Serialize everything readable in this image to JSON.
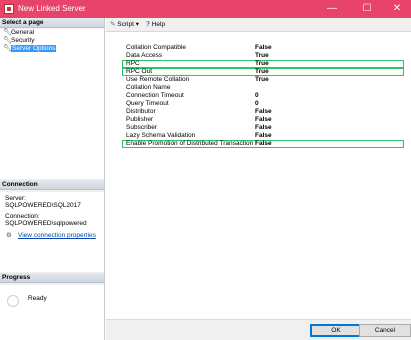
{
  "window": {
    "title": "New Linked Server",
    "minimize_glyph": "—",
    "maximize_glyph": "☐",
    "close_glyph": "✕"
  },
  "left_panel": {
    "select_page_header": "Select a page",
    "pages": [
      {
        "label": "General",
        "icon": "wrench-icon"
      },
      {
        "label": "Security",
        "icon": "wrench-icon"
      },
      {
        "label": "Server Options",
        "icon": "wrench-icon"
      }
    ],
    "connection_header": "Connection",
    "server_label": "Server:",
    "server_value": "SQLPOWERED\\SQL2017",
    "connection_label": "Connection:",
    "connection_value": "SQLPOWERED\\sqlpowered",
    "view_connection_link": "View connection properties",
    "progress_header": "Progress",
    "progress_status": "Ready"
  },
  "toolbar": {
    "script_label": "Script",
    "help_label": "Help"
  },
  "properties": [
    {
      "name": "Collation Compatible",
      "value": "False",
      "highlight": false
    },
    {
      "name": "Data Access",
      "value": "True",
      "highlight": false
    },
    {
      "name": "RPC",
      "value": "True",
      "highlight": true
    },
    {
      "name": "RPC Out",
      "value": "True",
      "highlight": true
    },
    {
      "name": "Use Remote Collation",
      "value": "True",
      "highlight": false
    },
    {
      "name": "Collation Name",
      "value": "",
      "highlight": false
    },
    {
      "name": "Connection Timeout",
      "value": "0",
      "highlight": false
    },
    {
      "name": "Query Timeout",
      "value": "0",
      "highlight": false
    },
    {
      "name": "Distributor",
      "value": "False",
      "highlight": false
    },
    {
      "name": "Publisher",
      "value": "False",
      "highlight": false
    },
    {
      "name": "Subscriber",
      "value": "False",
      "highlight": false
    },
    {
      "name": "Lazy Schema Validation",
      "value": "False",
      "highlight": false
    },
    {
      "name": "Enable Promotion of Distributed Transaction",
      "value": "False",
      "highlight": true
    }
  ],
  "colors": {
    "titlebar": "#e8436a",
    "selection": "#3399ff",
    "highlight_border": "#2cc36b"
  },
  "footer": {
    "ok_label": "OK",
    "cancel_label": "Cancel"
  }
}
